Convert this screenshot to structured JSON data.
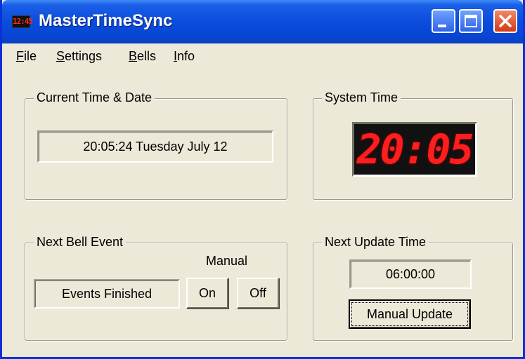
{
  "window": {
    "title": "MasterTimeSync",
    "app_icon_text": "12:45"
  },
  "menu": {
    "items": [
      {
        "prefix": "",
        "accel": "F",
        "rest": "ile"
      },
      {
        "prefix": "",
        "accel": "S",
        "rest": "ettings"
      },
      {
        "prefix": "",
        "accel": "B",
        "rest": "ells"
      },
      {
        "prefix": "",
        "accel": "I",
        "rest": "nfo"
      }
    ]
  },
  "current_time": {
    "label": "Current Time & Date",
    "value": "20:05:24 Tuesday July 12"
  },
  "system_time": {
    "label": "System Time",
    "display": "20:05"
  },
  "next_bell": {
    "label": "Next Bell Event",
    "status": "Events Finished",
    "manual_label": "Manual",
    "on_label": "On",
    "off_label": "Off"
  },
  "next_update": {
    "label": "Next Update Time",
    "value": "06:00:00",
    "button_label": "Manual Update"
  },
  "colors": {
    "titlebar": "#0a4ddc",
    "clock_digits": "#ff1e1e",
    "close_button": "#d33a14"
  }
}
